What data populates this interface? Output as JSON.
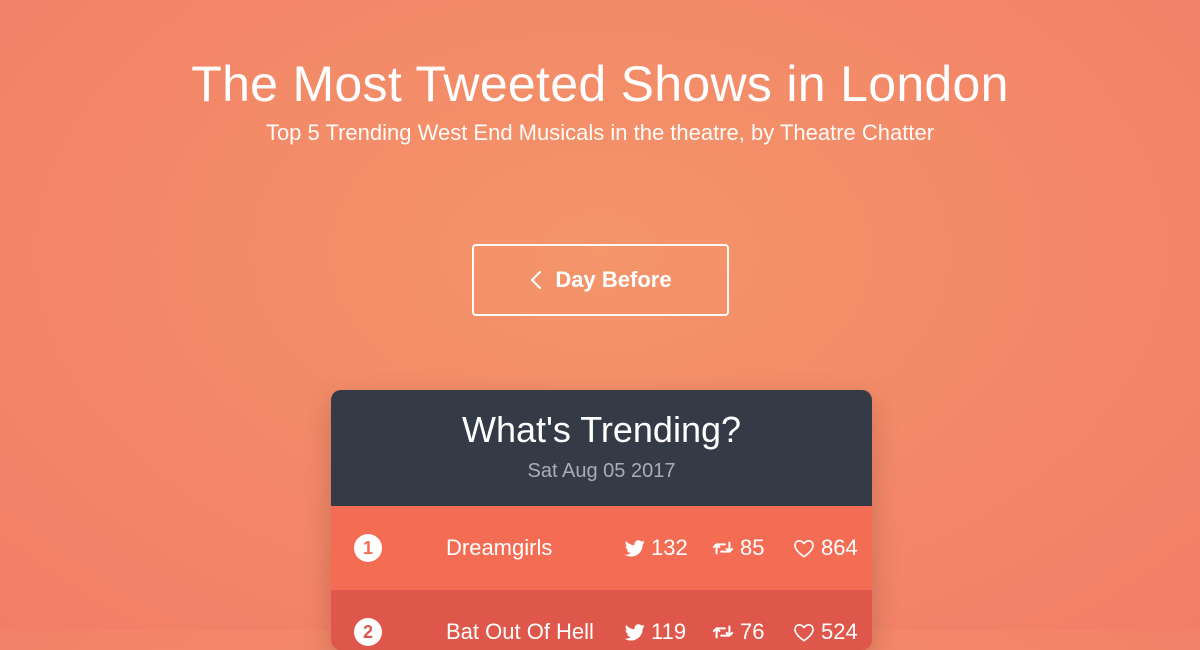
{
  "hero": {
    "title": "The Most Tweeted Shows in London",
    "subtitle": "Top 5 Trending West End Musicals in the theatre, by Theatre Chatter"
  },
  "navigation": {
    "previous_label": "Day Before",
    "previous_icon": "chevron-left-icon"
  },
  "card": {
    "title": "What's Trending?",
    "date": "Sat Aug 05 2017",
    "rows": [
      {
        "rank": "1",
        "show": "Dreamgirls",
        "tweets": "132",
        "retweets": "85",
        "likes": "864"
      },
      {
        "rank": "2",
        "show": "Bat Out Of Hell",
        "tweets": "119",
        "retweets": "76",
        "likes": "524"
      }
    ]
  },
  "icons": {
    "tweets": "twitter-bird-icon",
    "retweets": "retweet-icon",
    "likes": "heart-icon"
  },
  "colors": {
    "background": "#f38868",
    "card_header": "#353a47",
    "row_1": "#f56c55",
    "row_2": "#df574b",
    "date_text": "#a9adb7",
    "text": "#ffffff"
  }
}
